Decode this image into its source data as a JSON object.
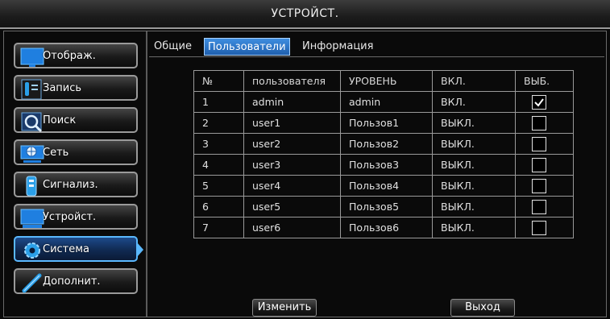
{
  "window": {
    "title": "УСТРОЙСТ."
  },
  "sidebar": {
    "items": [
      {
        "label": "Отображ.",
        "icon": "monitor-icon"
      },
      {
        "label": "Запись",
        "icon": "record-icon"
      },
      {
        "label": "Поиск",
        "icon": "search-icon"
      },
      {
        "label": "Сеть",
        "icon": "network-icon"
      },
      {
        "label": "Сигнализ.",
        "icon": "alarm-icon"
      },
      {
        "label": "Устройст.",
        "icon": "device-icon"
      },
      {
        "label": "Система",
        "icon": "gear-icon",
        "active": true
      },
      {
        "label": "Дополнит.",
        "icon": "tools-icon"
      }
    ]
  },
  "tabs": [
    {
      "label": "Общие",
      "active": false
    },
    {
      "label": "Пользователи",
      "active": true
    },
    {
      "label": "Информация",
      "active": false
    }
  ],
  "table": {
    "headers": [
      "№",
      "пользователя",
      "УРОВЕНЬ",
      "ВКЛ.",
      "ВЫБ."
    ],
    "rows": [
      {
        "num": "1",
        "user": "admin",
        "level": "admin",
        "state": "ВКЛ.",
        "checked": true
      },
      {
        "num": "2",
        "user": "user1",
        "level": "Пользов1",
        "state": "ВЫКЛ.",
        "checked": false
      },
      {
        "num": "3",
        "user": "user2",
        "level": "Пользов2",
        "state": "ВЫКЛ.",
        "checked": false
      },
      {
        "num": "4",
        "user": "user3",
        "level": "Пользов3",
        "state": "ВЫКЛ.",
        "checked": false
      },
      {
        "num": "5",
        "user": "user4",
        "level": "Пользов4",
        "state": "ВЫКЛ.",
        "checked": false
      },
      {
        "num": "6",
        "user": "user5",
        "level": "Пользов5",
        "state": "ВЫКЛ.",
        "checked": false
      },
      {
        "num": "7",
        "user": "user6",
        "level": "Пользов6",
        "state": "ВЫКЛ.",
        "checked": false
      }
    ]
  },
  "buttons": {
    "edit": "Изменить",
    "exit": "Выход"
  },
  "colors": {
    "accent": "#3f8ee0",
    "active_border": "#5ab8ff",
    "background": "#0a0a0a"
  }
}
